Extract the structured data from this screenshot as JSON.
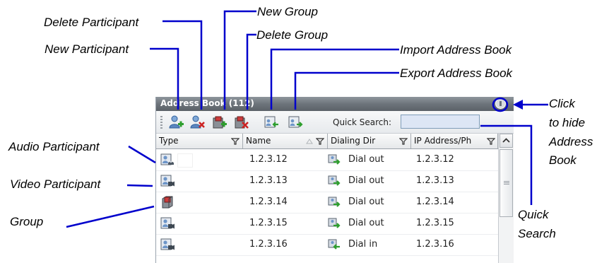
{
  "callouts": {
    "delete_participant": "Delete Participant",
    "new_group": "New Group",
    "delete_group": "Delete Group",
    "new_participant": "New Participant",
    "import_address_book": "Import Address Book",
    "export_address_book": "Export Address Book",
    "click_to_hide_1": "Click",
    "click_to_hide_2": "to hide",
    "click_to_hide_3": "Address",
    "click_to_hide_4": "Book",
    "audio_participant": "Audio Participant",
    "video_participant": "Video Participant",
    "group": "Group",
    "quick_search_1": "Quick",
    "quick_search_2": "Search"
  },
  "panel": {
    "title": "Address Book (112)",
    "quick_search_label": "Quick Search:",
    "quick_search_value": ""
  },
  "columns": [
    "Type",
    "Name",
    "Dialing Dir",
    "IP Address/Ph"
  ],
  "rows": [
    {
      "type": "audio-participant",
      "name": "1.2.3.12",
      "dialing_dir": "Dial out",
      "ip": "1.2.3.12"
    },
    {
      "type": "video-participant",
      "name": "1.2.3.13",
      "dialing_dir": "Dial out",
      "ip": "1.2.3.13"
    },
    {
      "type": "group",
      "name": "1.2.3.14",
      "dialing_dir": "Dial out",
      "ip": "1.2.3.14"
    },
    {
      "type": "video-participant",
      "name": "1.2.3.15",
      "dialing_dir": "Dial out",
      "ip": "1.2.3.15"
    },
    {
      "type": "video-participant",
      "name": "1.2.3.16",
      "dialing_dir": "Dial in",
      "ip": "1.2.3.16"
    }
  ],
  "colors": {
    "callout_line": "#0000cc",
    "titlebar": "#6d747b",
    "search_field": "#dde6f5",
    "add_green": "#2e9e2e",
    "delete_red": "#cc2222"
  }
}
